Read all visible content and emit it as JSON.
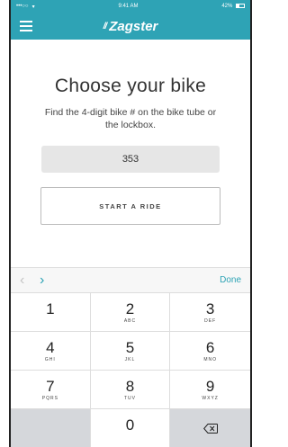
{
  "status_bar": {
    "signal": "•••○○",
    "time": "9:41 AM",
    "battery_percent": "42%"
  },
  "nav": {
    "brand_mark": "ℤ",
    "brand_name": "Zagster"
  },
  "main": {
    "title": "Choose your bike",
    "instructions": "Find the 4-digit bike # on the bike tube or the lockbox.",
    "bike_number_value": "353",
    "start_button_label": "START A RIDE"
  },
  "keyboard": {
    "done_label": "Done",
    "prev_arrow": "‹",
    "next_arrow": "›",
    "keys": [
      {
        "digit": "1",
        "letters": ""
      },
      {
        "digit": "2",
        "letters": "ABC"
      },
      {
        "digit": "3",
        "letters": "DEF"
      },
      {
        "digit": "4",
        "letters": "GHI"
      },
      {
        "digit": "5",
        "letters": "JKL"
      },
      {
        "digit": "6",
        "letters": "MNO"
      },
      {
        "digit": "7",
        "letters": "PQRS"
      },
      {
        "digit": "8",
        "letters": "TUV"
      },
      {
        "digit": "9",
        "letters": "WXYZ"
      },
      {
        "digit": "0",
        "letters": ""
      }
    ]
  },
  "colors": {
    "brand": "#2ea3b5",
    "keyboard_gray": "#d5d7db"
  }
}
